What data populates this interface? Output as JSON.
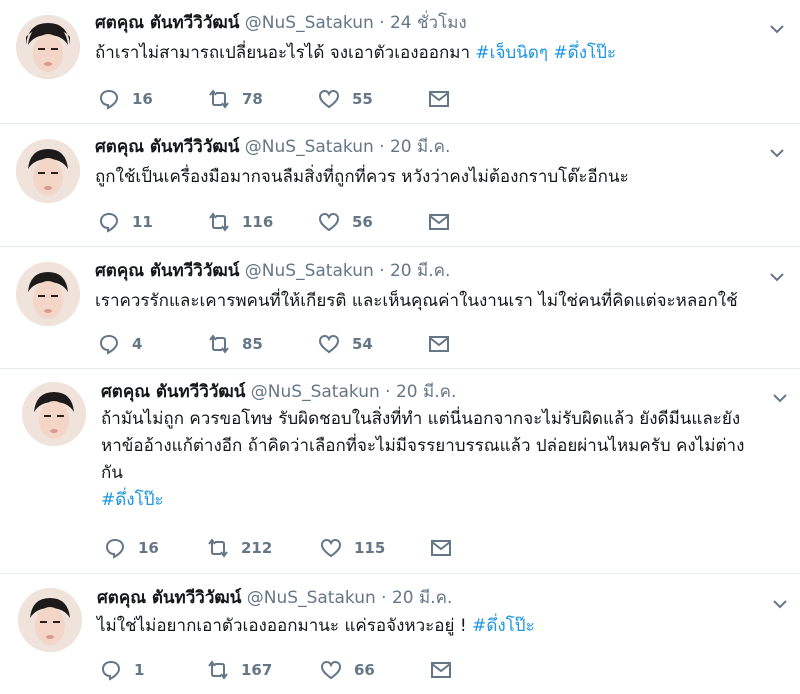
{
  "tweets": [
    {
      "name": "ศตคุณ ตันทวีวิวัฒน์",
      "handle": "@NuS_Satakun",
      "dot": "·",
      "time": "24 ชั่วโมง",
      "text": "ถ้าเราไม่สามารถเปลี่ยนอะไรได้ จงเอาตัวเองออกมา",
      "hashtags": [
        "#เจ็บนิดๆ",
        "#ดึ่งโป๊ะ"
      ],
      "replies": "16",
      "retweets": "78",
      "likes": "55"
    },
    {
      "name": "ศตคุณ ตันทวีวิวัฒน์",
      "handle": "@NuS_Satakun",
      "dot": "·",
      "time": "20 มี.ค.",
      "text": "ถูกใช้เป็นเครื่องมือมากจนลืมสิ่งที่ถูกที่ควร หวังว่าคงไม่ต้องกราบโต๊ะอีกนะ",
      "replies": "11",
      "retweets": "116",
      "likes": "56"
    },
    {
      "name": "ศตคุณ ตันทวีวิวัฒน์",
      "handle": "@NuS_Satakun",
      "dot": "·",
      "time": "20 มี.ค.",
      "text": "เราควรรักและเคารพคนที่ให้เกียรติ และเห็นคุณค่าในงานเรา ไม่ใช่คนที่คิดแต่จะหลอกใช้",
      "replies": "4",
      "retweets": "85",
      "likes": "54"
    },
    {
      "name": "ศตคุณ ตันทวีวิวัฒน์",
      "handle": "@NuS_Satakun",
      "dot": "·",
      "time": "20 มี.ค.",
      "text_lines": [
        "ถ้ามันไม่ถูก ควรขอโทษ รับผิดชอบในสิ่งที่ทำ แต่นี่นอกจากจะไม่รับผิดแล้ว ยังดีมีนและยัง",
        "หาข้ออ้างแก้ต่างอีก ถ้าคิดว่าเลือกที่จะไม่มีจรรยาบรรณแล้ว ปล่อยผ่านไหมครับ คงไม่ต่าง",
        "กัน"
      ],
      "hashtags": [
        "#ดึ่งโป๊ะ"
      ],
      "replies": "16",
      "retweets": "212",
      "likes": "115"
    },
    {
      "name": "ศตคุณ ตันทวีวิวัฒน์",
      "handle": "@NuS_Satakun",
      "dot": "·",
      "time": "20 มี.ค.",
      "text": "ไม่ใช่ไม่อยากเอาตัวเองออกมานะ แค่รอจังหวะอยู่ !",
      "hashtags": [
        "#ดึ่งโป๊ะ"
      ],
      "replies": "1",
      "retweets": "167",
      "likes": "66"
    }
  ],
  "icons": {
    "reply": "reply-icon",
    "retweet": "retweet-icon",
    "like": "heart-icon",
    "message": "envelope-icon",
    "caret": "chevron-down-icon"
  },
  "colors": {
    "name": "#14171a",
    "muted": "#657786",
    "hashtag": "#1b95e0",
    "divider": "#e6ecf0"
  }
}
